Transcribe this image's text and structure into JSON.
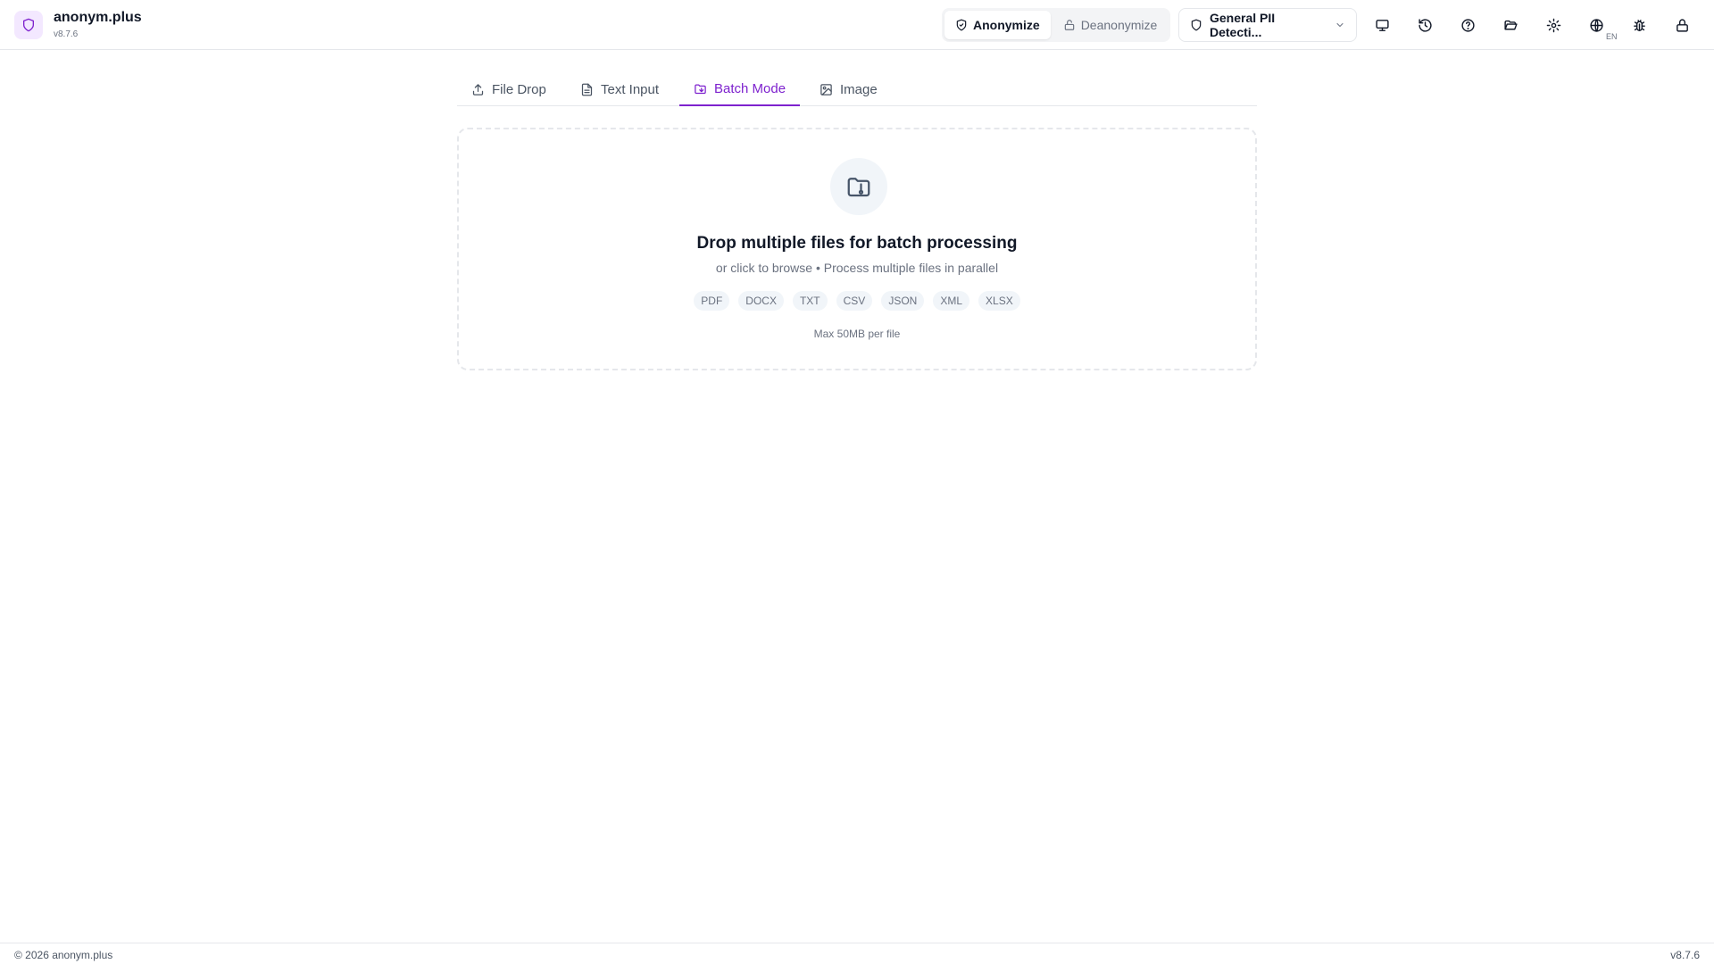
{
  "app": {
    "name": "anonym.plus",
    "version": "v8.7.6"
  },
  "header": {
    "mode": {
      "anonymize_label": "Anonymize",
      "deanonymize_label": "Deanonymize",
      "active": "anonymize"
    },
    "profile_select": {
      "value": "General PII Detecti..."
    },
    "icons": [
      "monitor-icon",
      "history-icon",
      "help-icon",
      "folder-open-icon",
      "settings-icon",
      "globe-icon",
      "bug-icon",
      "lock-icon"
    ],
    "language_code": "EN"
  },
  "tabs": [
    {
      "label": "File Drop",
      "icon": "upload-icon"
    },
    {
      "label": "Text Input",
      "icon": "file-text-icon"
    },
    {
      "label": "Batch Mode",
      "icon": "folder-icon",
      "active": true
    },
    {
      "label": "Image",
      "icon": "image-icon"
    }
  ],
  "dropzone": {
    "title": "Drop multiple files for batch processing",
    "subtitle": "or click to browse • Process multiple files in parallel",
    "formats": [
      "PDF",
      "DOCX",
      "TXT",
      "CSV",
      "JSON",
      "XML",
      "XLSX"
    ],
    "max_size": "Max 50MB per file"
  },
  "footer": {
    "copyright": "© 2026 anonym.plus",
    "version": "v8.7.6"
  },
  "colors": {
    "accent": "#7e22ce",
    "accent_bg": "#f3e8ff",
    "border": "#e5e7eb",
    "muted_text": "#6b7280"
  }
}
